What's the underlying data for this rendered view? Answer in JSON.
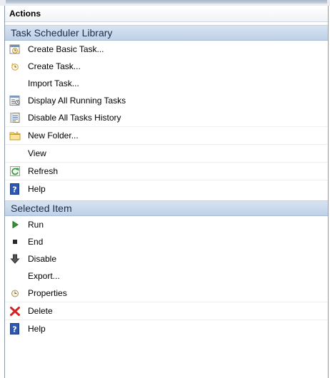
{
  "pane": {
    "title": "Actions",
    "sections": [
      {
        "title": "Task Scheduler Library",
        "items": [
          {
            "label": "Create Basic Task...",
            "icon": "create-basic-task-icon"
          },
          {
            "label": "Create Task...",
            "icon": "create-task-icon"
          },
          {
            "label": "Import Task...",
            "icon": ""
          },
          {
            "label": "Display All Running Tasks",
            "icon": "running-tasks-icon"
          },
          {
            "label": "Disable All Tasks History",
            "icon": "tasks-history-icon"
          },
          {
            "label": "New Folder...",
            "icon": "folder-icon"
          },
          {
            "label": "View",
            "icon": ""
          },
          {
            "label": "Refresh",
            "icon": "refresh-icon"
          },
          {
            "label": "Help",
            "icon": "help-icon"
          }
        ]
      },
      {
        "title": "Selected Item",
        "items": [
          {
            "label": "Run",
            "icon": "run-icon"
          },
          {
            "label": "End",
            "icon": "end-icon"
          },
          {
            "label": "Disable",
            "icon": "disable-icon"
          },
          {
            "label": "Export...",
            "icon": ""
          },
          {
            "label": "Properties",
            "icon": "properties-icon"
          },
          {
            "label": "Delete",
            "icon": "delete-icon"
          },
          {
            "label": "Help",
            "icon": "help-icon"
          }
        ]
      }
    ]
  },
  "colors": {
    "section_bg": "#c7d7ea",
    "section_text": "#1b2e4a",
    "border": "#8d9aab"
  }
}
